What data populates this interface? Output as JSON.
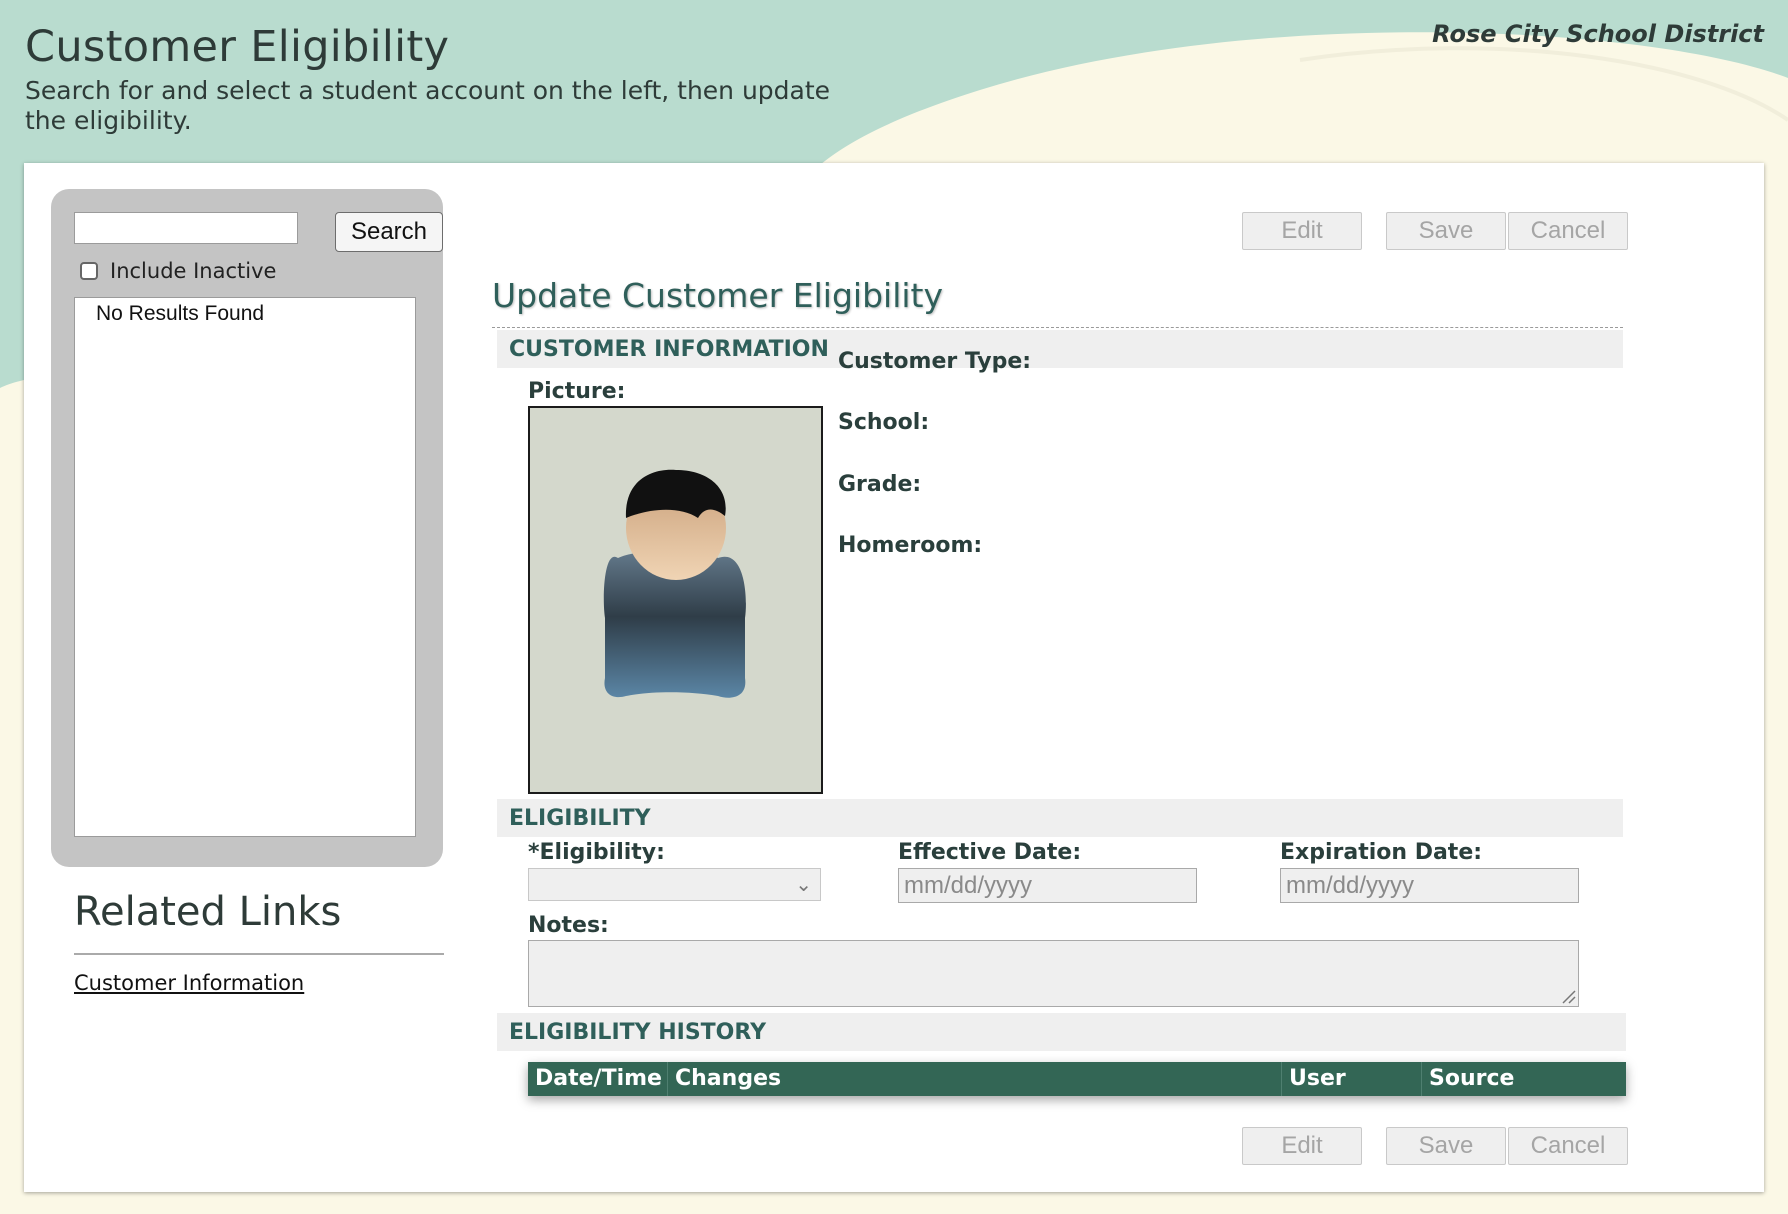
{
  "header": {
    "title": "Customer Eligibility",
    "description": "Search for and select a student account on the left, then update the eligibility.",
    "district": "Rose City School District"
  },
  "search": {
    "input_value": "",
    "button_label": "Search",
    "include_inactive_label": "Include Inactive",
    "include_inactive_checked": false,
    "results_text": "No Results Found"
  },
  "related_links": {
    "title": "Related Links",
    "items": [
      {
        "label": "Customer Information"
      }
    ]
  },
  "actions": {
    "edit": "Edit",
    "save": "Save",
    "cancel": "Cancel"
  },
  "form": {
    "title": "Update Customer Eligibility",
    "customer_info": {
      "header": "CUSTOMER INFORMATION",
      "picture_label": "Picture:",
      "customer_type_label": "Customer Type:",
      "school_label": "School:",
      "grade_label": "Grade:",
      "homeroom_label": "Homeroom:"
    },
    "eligibility": {
      "header": "ELIGIBILITY",
      "eligibility_label": "*Eligibility:",
      "eligibility_value": "",
      "effective_date_label": "Effective Date:",
      "effective_date_placeholder": "mm/dd/yyyy",
      "expiration_date_label": "Expiration Date:",
      "expiration_date_placeholder": "mm/dd/yyyy",
      "notes_label": "Notes:",
      "notes_value": ""
    },
    "history": {
      "header": "ELIGIBILITY HISTORY",
      "columns": [
        "Date/Time",
        "Changes",
        "User",
        "Source"
      ],
      "rows": []
    }
  },
  "colors": {
    "header_band": "#b9dccf",
    "accent_green": "#336655",
    "title_teal": "#2f5f5a",
    "cream": "#fbf8e6"
  }
}
